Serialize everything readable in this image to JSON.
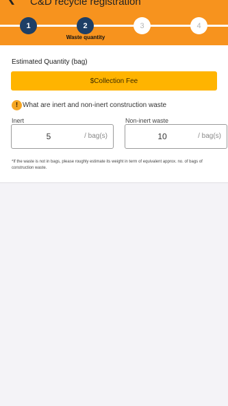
{
  "header": {
    "back_icon": "chevron-left-icon",
    "title": "C&D recycle registration",
    "accent_color": "#f7931e"
  },
  "stepper": {
    "steps": [
      {
        "number": "1",
        "state": "done"
      },
      {
        "number": "2",
        "state": "current"
      },
      {
        "number": "3",
        "state": "pending"
      },
      {
        "number": "4",
        "state": "pending"
      }
    ],
    "current_label": "Waste quantity",
    "active_color": "#1e3f66"
  },
  "form": {
    "section_title": "Estimated Quantity (bag)",
    "fee_button_label": "$Collection Fee",
    "fee_button_color": "#ffb400",
    "info_icon": "exclamation-icon",
    "info_text": "What are inert and non-inert construction waste",
    "inert": {
      "label": "Inert",
      "value": "5",
      "unit": "/ bag(s)"
    },
    "non_inert": {
      "label": "Non-inert waste",
      "value": "10",
      "unit": "/ bag(s)"
    },
    "footnote": "*If the waste is not in bags, please roughly estimate its weight in term of equivalent approx. no. of bags of construction waste."
  }
}
